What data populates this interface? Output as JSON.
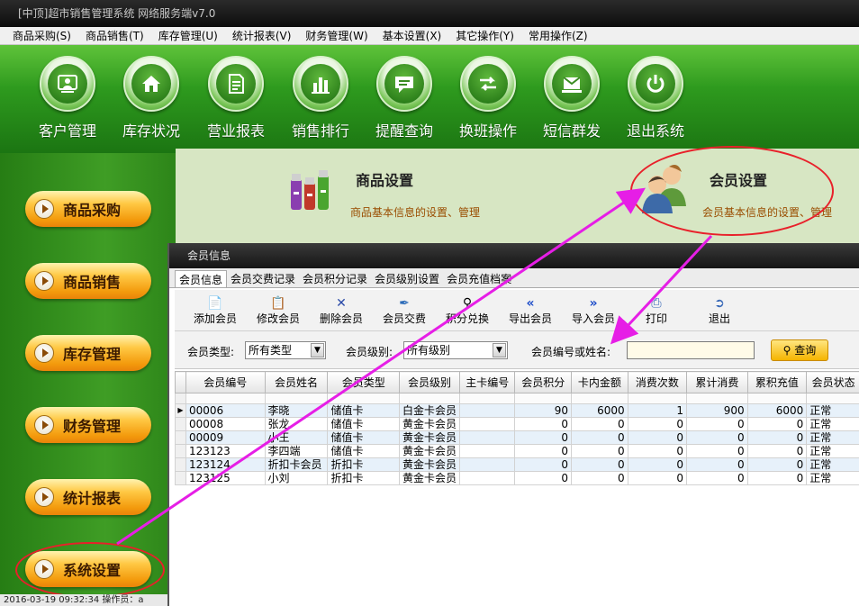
{
  "window": {
    "title": "[中顶]超市销售管理系统 网络服务端v7.0"
  },
  "menubar": [
    "商品采购(S)",
    "商品销售(T)",
    "库存管理(U)",
    "统计报表(V)",
    "财务管理(W)",
    "基本设置(X)",
    "其它操作(Y)",
    "常用操作(Z)"
  ],
  "top_toolbar": [
    {
      "label": "客户管理",
      "icon": "customer-icon"
    },
    {
      "label": "库存状况",
      "icon": "home-icon"
    },
    {
      "label": "营业报表",
      "icon": "report-icon"
    },
    {
      "label": "销售排行",
      "icon": "bar-chart-icon"
    },
    {
      "label": "提醒查询",
      "icon": "message-icon"
    },
    {
      "label": "换班操作",
      "icon": "swap-icon"
    },
    {
      "label": "短信群发",
      "icon": "mail-icon"
    },
    {
      "label": "退出系统",
      "icon": "power-icon"
    }
  ],
  "sidenav": [
    "商品采购",
    "商品销售",
    "库存管理",
    "财务管理",
    "统计报表",
    "系统设置"
  ],
  "statusbar": {
    "text": "2016-03-19 09:32:34   操作员：a"
  },
  "content": {
    "product": {
      "title": "商品设置",
      "desc": "商品基本信息的设置、管理"
    },
    "member": {
      "title": "会员设置",
      "desc": "会员基本信息的设置、管理"
    }
  },
  "dialog": {
    "title": "会员信息",
    "tabs": [
      "会员信息",
      "会员交费记录",
      "会员积分记录",
      "会员级别设置",
      "会员充值档案"
    ],
    "toolbar": [
      {
        "label": "添加会员",
        "icon": "add-doc-icon"
      },
      {
        "label": "修改会员",
        "icon": "edit-icon"
      },
      {
        "label": "删除会员",
        "icon": "delete-icon"
      },
      {
        "label": "会员交费",
        "icon": "pen-icon"
      },
      {
        "label": "积分兑换",
        "icon": "search-icon"
      },
      {
        "label": "导出会员",
        "icon": "double-left-icon"
      },
      {
        "label": "导入会员",
        "icon": "double-right-icon"
      },
      {
        "label": "打印",
        "icon": "printer-icon"
      },
      {
        "label": "退出",
        "icon": "exit-icon"
      }
    ],
    "filters": {
      "type_label": "会员类型:",
      "type_value": "所有类型",
      "level_label": "会员级别:",
      "level_value": "所有级别",
      "search_label": "会员编号或姓名:",
      "search_value": "",
      "query_label": "查询"
    },
    "columns": [
      "会员编号",
      "会员姓名",
      "会员类型",
      "会员级别",
      "主卡编号",
      "会员积分",
      "卡内金额",
      "消费次数",
      "累计消费",
      "累积充值",
      "会员状态"
    ],
    "rows": [
      [
        "00006",
        "李晓",
        "储值卡",
        "白金卡会员",
        "",
        "90",
        "6000",
        "1",
        "900",
        "6000",
        "正常"
      ],
      [
        "00008",
        "张龙",
        "储值卡",
        "黄金卡会员",
        "",
        "0",
        "0",
        "0",
        "0",
        "0",
        "正常"
      ],
      [
        "00009",
        "小王",
        "储值卡",
        "黄金卡会员",
        "",
        "0",
        "0",
        "0",
        "0",
        "0",
        "正常"
      ],
      [
        "123123",
        "李四端",
        "储值卡",
        "黄金卡会员",
        "",
        "0",
        "0",
        "0",
        "0",
        "0",
        "正常"
      ],
      [
        "123124",
        "折扣卡会员",
        "折扣卡",
        "黄金卡会员",
        "",
        "0",
        "0",
        "0",
        "0",
        "0",
        "正常"
      ],
      [
        "123125",
        "小刘",
        "折扣卡",
        "黄金卡会员",
        "",
        "0",
        "0",
        "0",
        "0",
        "0",
        "正常"
      ]
    ]
  },
  "colors": {
    "annotation": "#e8202a",
    "arrow": "#e61ee6",
    "accent_green": "#2e9a1e",
    "nav_orange": "#f39a0c"
  }
}
